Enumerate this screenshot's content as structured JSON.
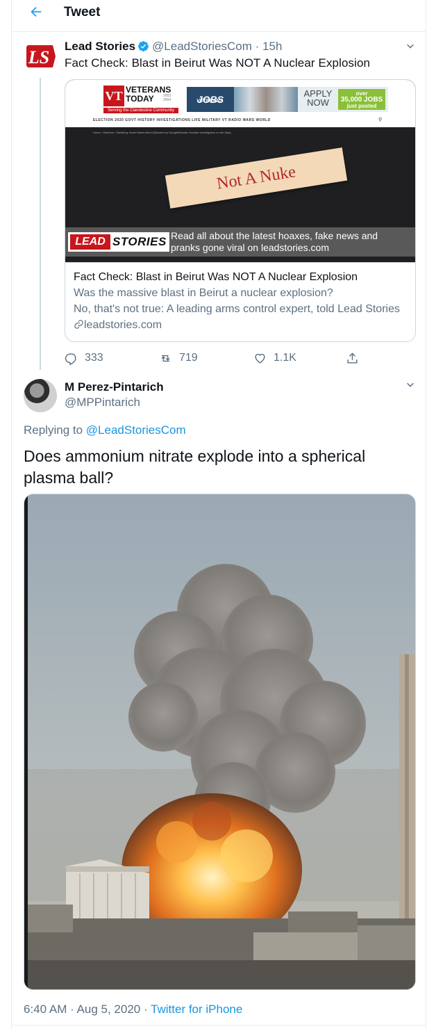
{
  "header": {
    "title": "Tweet",
    "back_icon": "arrow-left-icon"
  },
  "tweet": {
    "author_name": "Lead Stories",
    "author_handle": "@LeadStoriesCom",
    "time": "· 15h",
    "text": "Fact Check: Blast in Beirut Was NOT A Nuclear Explosion",
    "avatar_text": "LS",
    "card": {
      "image": {
        "vt_letters": "VT",
        "vt_name": "VETERANS TODAY",
        "vt_tagline": "Serving the Clandestine Community",
        "vt_years": "2003 2004",
        "jobs_label": "JOBS",
        "jobs_sublabel": "VETERANS",
        "apply_label": "APPLY NOW",
        "jobs_over": "over",
        "jobs_count": "35,000 JOBS",
        "jobs_posted": "just posted",
        "nav_items": "ELECTION 2020    GOVT    HISTORY    INVESTIGATIONS    LIFE    MILITARY    VT RADIO    WARS    WORLD",
        "breadcrumb": "Home › WarZone › Breaking: Israel Nukes Beirut (Blocked by Google/Russian Nuclear Investigators on the Way)",
        "note": "Not A Nuke",
        "ls_lead": "LEAD",
        "ls_stories": "STORIES",
        "ls_tagline": "Read all about the latest hoaxes, fake news and pranks gone viral on leadstories.com"
      },
      "title": "Fact Check: Blast in Beirut Was NOT A Nuclear Explosion",
      "description_line1": "Was the massive blast in Beirut a nuclear explosion?",
      "description_line2": "No, that's not true: A leading arms control expert, told Lead Stories",
      "domain": "leadstories.com"
    },
    "stats": {
      "replies": "333",
      "retweets": "719",
      "likes": "1.1K"
    }
  },
  "reply": {
    "author_name": "M Perez-Pintarich",
    "author_handle": "@MPPintarich",
    "replying_prefix": "Replying to ",
    "replying_to": "@LeadStoriesCom",
    "text": "Does ammonium nitrate explode into a spherical plasma ball?",
    "timestamp": "6:40 AM · Aug 5, 2020 · ",
    "source": "Twitter for iPhone"
  },
  "colors": {
    "accent": "#1da1f2",
    "link": "#1b95e0",
    "secondary_text": "#5b7083",
    "border": "#e6ecf0"
  }
}
